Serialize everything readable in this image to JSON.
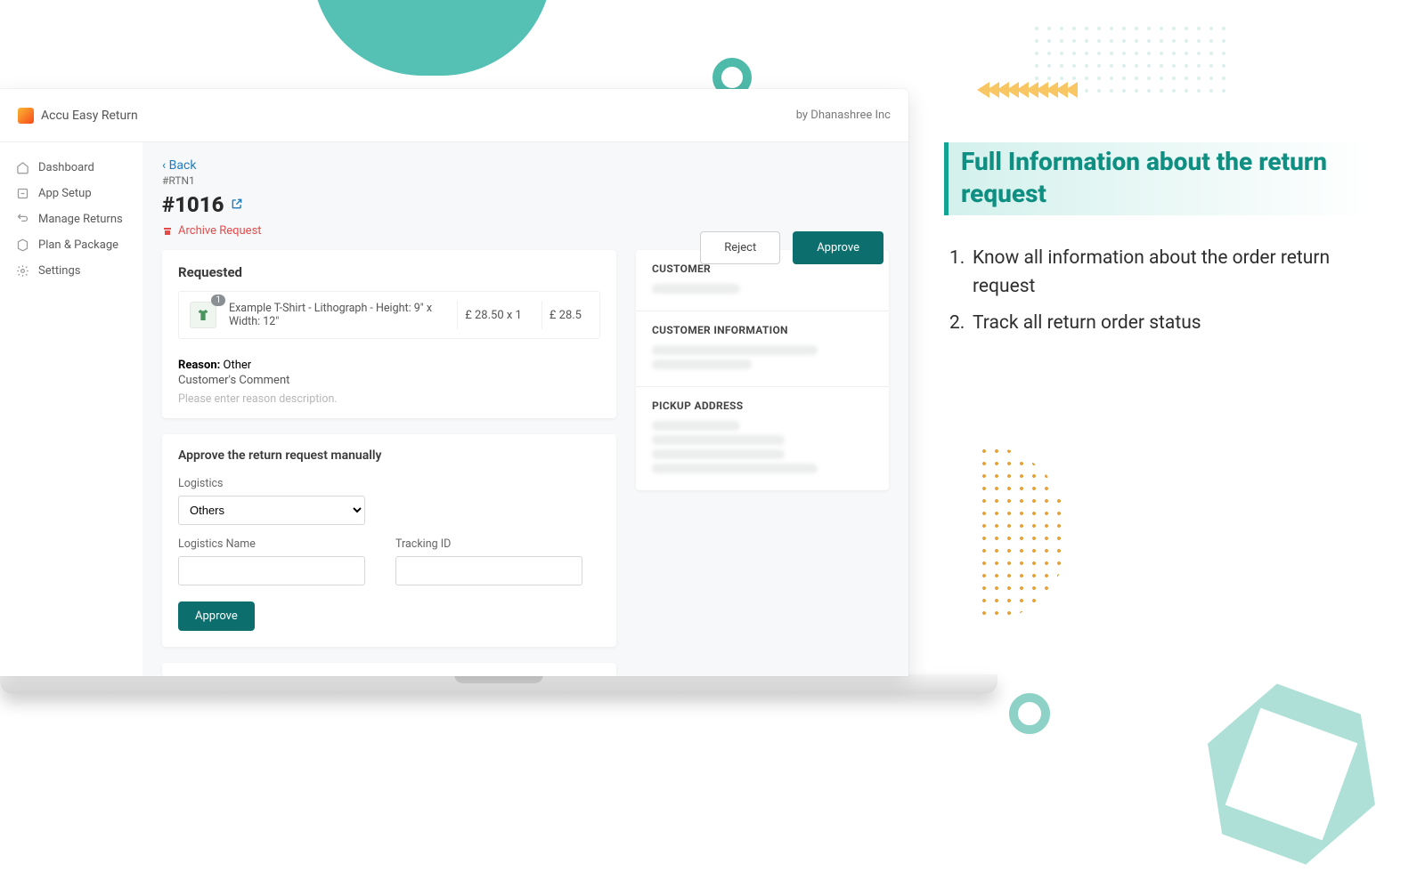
{
  "brand": {
    "name": "Accu Easy Return",
    "by": "by Dhanashree Inc"
  },
  "sidebar": {
    "items": [
      {
        "label": "Dashboard"
      },
      {
        "label": "App Setup"
      },
      {
        "label": "Manage Returns"
      },
      {
        "label": "Plan & Package"
      },
      {
        "label": "Settings"
      }
    ]
  },
  "page": {
    "back": "‹ Back",
    "return_id": "#RTN1",
    "order_title": "#1016",
    "archive": "Archive Request",
    "reject": "Reject",
    "approve": "Approve"
  },
  "requested": {
    "title": "Requested",
    "product": {
      "name": "Example T-Shirt - Lithograph - Height: 9\" x Width: 12\"",
      "qty": "1",
      "unit_price": "£ 28.50 x 1",
      "total": "£ 28.5"
    },
    "reason_label": "Reason:",
    "reason_value": "Other",
    "comment_label": "Customer's Comment",
    "placeholder": "Please enter reason description."
  },
  "approve_form": {
    "title": "Approve the return request manually",
    "logistics_label": "Logistics",
    "logistics_option": "Others",
    "logistics_name_label": "Logistics Name",
    "tracking_label": "Tracking ID",
    "approve_btn": "Approve"
  },
  "right": {
    "customer": "CUSTOMER",
    "customer_info": "CUSTOMER INFORMATION",
    "pickup": "PICKUP ADDRESS"
  },
  "desc": {
    "title": "Full Information about the return request",
    "items": [
      "Know all information about the order return request",
      "Track all return order status"
    ]
  }
}
